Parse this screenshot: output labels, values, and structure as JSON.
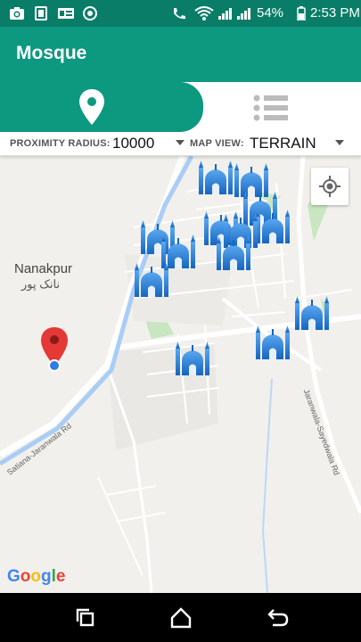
{
  "status_bar": {
    "battery_percent": "54%",
    "time": "2:53 PM",
    "icons": [
      "camera-icon",
      "sim-card-icon",
      "id-card-icon",
      "chrome-icon",
      "phone-call-icon",
      "wifi-icon",
      "signal-icon",
      "signal-icon",
      "battery-icon"
    ]
  },
  "app_bar": {
    "title": "Mosque"
  },
  "tabs": [
    {
      "icon": "map-pin-icon",
      "selected": true
    },
    {
      "icon": "list-icon",
      "selected": false
    }
  ],
  "filters": {
    "radius_label": "PROXIMITY RADIUS:",
    "radius_value": "10000",
    "map_view_label": "MAP VIEW:",
    "map_view_value": "TERRAIN"
  },
  "map": {
    "place_name": "Nanakpur",
    "place_name_urdu": "نانک پور",
    "road_labels": [
      "Satiana-Jaranwala Rd",
      "Jaranwala-Sayedwala Rd"
    ],
    "google_logo": "Google",
    "markers": {
      "mosque_count": 13,
      "selected_marker": "red-pin"
    }
  },
  "colors": {
    "primary": "#0d9880",
    "primary_dark": "#0a7d68",
    "mosque_blue": "#1565c0",
    "pin_red": "#e53935"
  },
  "nav_bar": {
    "buttons": [
      "recent-apps-icon",
      "home-icon",
      "back-icon"
    ]
  }
}
